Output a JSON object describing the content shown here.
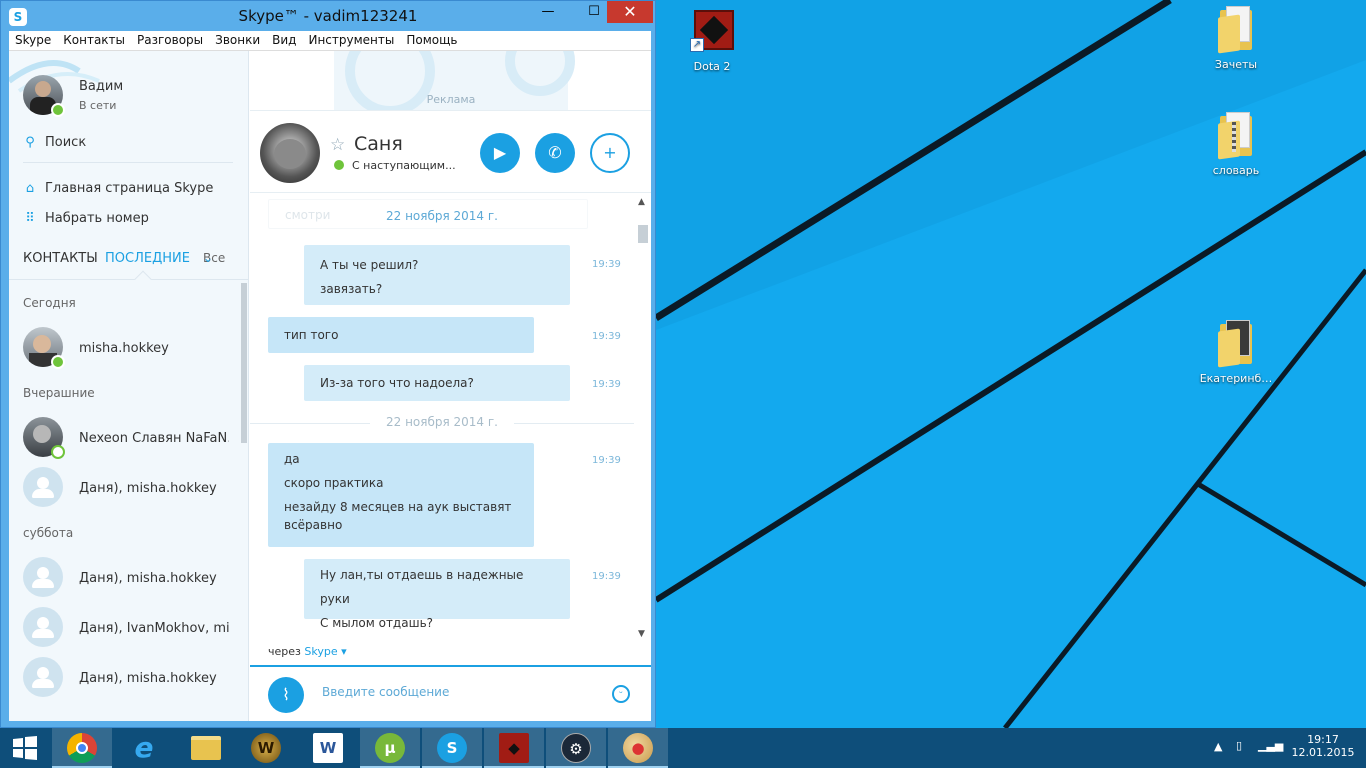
{
  "desktop": {
    "icons": [
      {
        "label": "Dota 2",
        "icon": "dota2-icon"
      },
      {
        "label": "Зачеты",
        "icon": "folder-icon"
      },
      {
        "label": "словарь",
        "icon": "zip-folder-icon"
      },
      {
        "label": "Екатеринб…",
        "icon": "folder-icon"
      }
    ]
  },
  "window": {
    "title": "Skype™ - vadim123241",
    "minimize": "—",
    "maximize": "☐",
    "close": "✕"
  },
  "menu": [
    "Skype",
    "Контакты",
    "Разговоры",
    "Звонки",
    "Вид",
    "Инструменты",
    "Помощь"
  ],
  "profile": {
    "name": "Вадим",
    "status": "В сети"
  },
  "sidebar": {
    "search": "Поиск",
    "home": "Главная страница Skype",
    "dial": "Набрать номер",
    "tabs": {
      "contacts": "КОНТАКТЫ",
      "recent": "ПОСЛЕДНИЕ",
      "filter": "Все"
    }
  },
  "recent": {
    "groups": [
      {
        "label": "Сегодня",
        "items": [
          {
            "name": "misha.hokkey",
            "avatar": "photo",
            "presence": "online"
          }
        ]
      },
      {
        "label": "Вчерашние",
        "items": [
          {
            "name": "Nexeon Славян NaFaN…",
            "avatar": "photo",
            "presence": "offline"
          },
          {
            "name": "Даня), misha.hokkey",
            "avatar": "group"
          }
        ]
      },
      {
        "label": "суббота",
        "items": [
          {
            "name": "Даня), misha.hokkey",
            "avatar": "group"
          },
          {
            "name": "Даня), IvanMokhov, mi…",
            "avatar": "group"
          },
          {
            "name": "Даня), misha.hokkey",
            "avatar": "group"
          }
        ]
      }
    ]
  },
  "ad": {
    "label": "Реклама"
  },
  "chat": {
    "contact_name": "Саня",
    "contact_status": "С наступающим...",
    "date_top": "22 ноября 2014 г.",
    "date_top_faded_text": "смотри",
    "date_mid": "22 ноября 2014 г.",
    "messages": [
      {
        "lines": [
          "А ты че решил?",
          "завязать?"
        ],
        "time": "19:39"
      },
      {
        "lines": [
          "тип того"
        ],
        "time": "19:39"
      },
      {
        "lines": [
          "Из-за того что надоела?"
        ],
        "time": "19:39"
      },
      {
        "lines": [
          "да",
          "скоро практика",
          "незайду 8 месяцев на аук выставят",
          "всёравно"
        ],
        "time": "19:39"
      },
      {
        "lines": [
          "Ну лан,ты отдаешь в надежные руки",
          "С мылом отдашь?"
        ],
        "time": "19:39"
      }
    ],
    "via_prefix": "через",
    "via_service": "Skype",
    "input_placeholder": "Введите сообщение"
  },
  "taskbar": {
    "apps": [
      "start",
      "chrome",
      "internet-explorer",
      "file-explorer",
      "world-of-warcraft",
      "word",
      "utorrent",
      "skype",
      "dota2",
      "steam",
      "paint"
    ],
    "time": "19:17",
    "date": "12.01.2015"
  }
}
